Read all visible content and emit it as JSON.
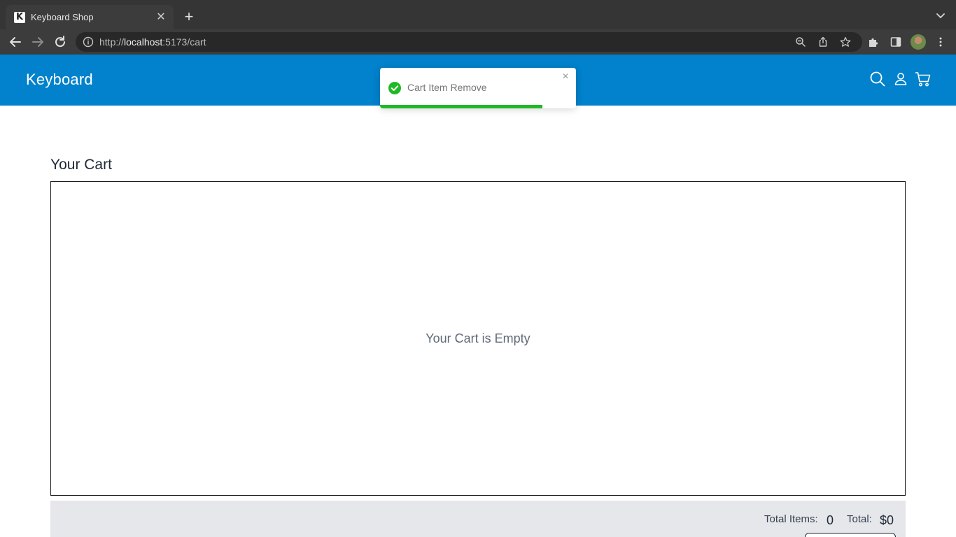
{
  "browser": {
    "tab_title": "Keyboard Shop",
    "favicon_letter": "K",
    "url_scheme": "http://",
    "url_host": "localhost",
    "url_rest": ":5173/cart"
  },
  "header": {
    "brand": "Keyboard",
    "icons": [
      "search-icon",
      "user-icon",
      "cart-icon"
    ]
  },
  "toast": {
    "message": "Cart Item Remove",
    "status": "success",
    "progress": 0.83,
    "accent_color": "#1fb925"
  },
  "cart": {
    "title": "Your Cart",
    "empty_message": "Your Cart is Empty"
  },
  "summary": {
    "total_items_label": "Total Items:",
    "total_items_value": "0",
    "total_label": "Total:",
    "total_value": "$0"
  },
  "colors": {
    "header_bg": "#0282cc",
    "summary_bg": "#e5e7eb"
  }
}
